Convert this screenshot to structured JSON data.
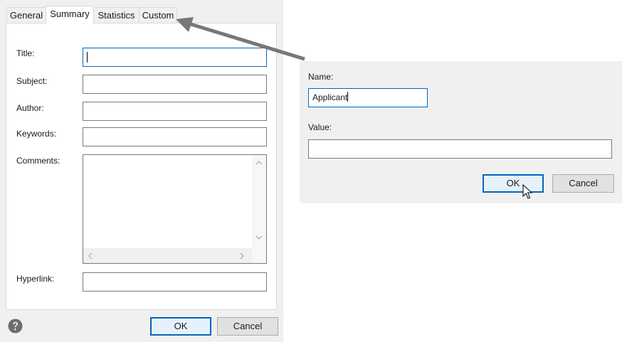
{
  "properties_dialog": {
    "tabs": [
      {
        "label": "General",
        "active": false
      },
      {
        "label": "Summary",
        "active": true
      },
      {
        "label": "Statistics",
        "active": false
      },
      {
        "label": "Custom",
        "active": false
      }
    ],
    "fields": {
      "title_label": "Title:",
      "title_value": "",
      "subject_label": "Subject:",
      "subject_value": "",
      "author_label": "Author:",
      "author_value": "",
      "keywords_label": "Keywords:",
      "keywords_value": "",
      "comments_label": "Comments:",
      "comments_value": "",
      "hyperlink_label": "Hyperlink:",
      "hyperlink_value": ""
    },
    "buttons": {
      "ok_label": "OK",
      "cancel_label": "Cancel"
    },
    "icons": {
      "help": "help-icon"
    }
  },
  "custom_property_dialog": {
    "name_label": "Name:",
    "name_value": "Applicant",
    "value_label": "Value:",
    "value_value": "",
    "buttons": {
      "ok_label": "OK",
      "cancel_label": "Cancel"
    }
  },
  "colors": {
    "dialog_bg": "#f0f0f0",
    "focus_blue": "#0067c0",
    "default_button_bg": "#e5f1fb",
    "button_bg": "#e1e1e1",
    "arrow_gray": "#777777"
  }
}
